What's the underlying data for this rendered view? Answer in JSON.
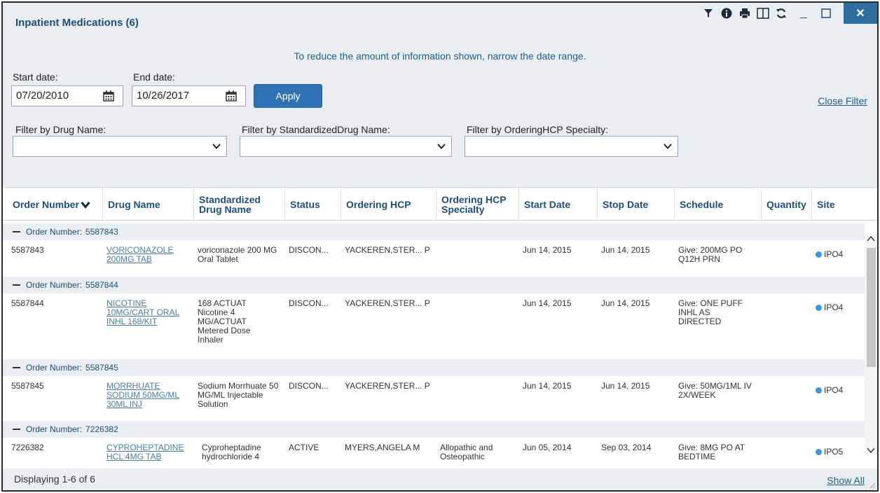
{
  "window": {
    "title": "Inpatient Medications (6)",
    "toolbar_icons": [
      "filter-icon",
      "info-icon",
      "print-icon",
      "columns-icon",
      "refresh-icon"
    ],
    "minimize_label": "_",
    "close_label": "✕"
  },
  "filters": {
    "hint": "To reduce the amount of information shown, narrow the date range.",
    "start_label": "Start date:",
    "start_value": "07/20/2010",
    "end_label": "End date:",
    "end_value": "10/26/2017",
    "apply_label": "Apply",
    "close_filter_label": "Close Filter",
    "drug_name_label": "Filter by Drug Name:",
    "standardized_label": "Filter by StandardizedDrug Name:",
    "specialty_label": "Filter by OrderingHCP Specialty:",
    "drug_name_value": "",
    "standardized_value": "",
    "specialty_value": ""
  },
  "columns": [
    {
      "label": "Order Number"
    },
    {
      "label": "Drug Name"
    },
    {
      "label": "Standardized Drug Name"
    },
    {
      "label": "Status"
    },
    {
      "label": "Ordering HCP"
    },
    {
      "label": "Ordering HCP Specialty"
    },
    {
      "label": "Start Date"
    },
    {
      "label": "Stop Date"
    },
    {
      "label": "Schedule"
    },
    {
      "label": "Quantity"
    },
    {
      "label": "Site"
    }
  ],
  "groups": [
    {
      "label": "Order Number:",
      "number": "5587843",
      "row": {
        "order": "5587843",
        "drug": "VORICONAZOLE 200MG TAB",
        "std": "voriconazole 200 MG Oral Tablet",
        "status": "DISCON...",
        "hcp": "YACKEREN,STER... P",
        "specialty": "",
        "start": "Jun 14, 2015",
        "stop": "Jun 14, 2015",
        "schedule": "Give: 200MG PO Q12H PRN",
        "quantity": "",
        "site": "IPO4"
      }
    },
    {
      "label": "Order Number:",
      "number": "5587844",
      "row": {
        "order": "5587844",
        "drug": "NICOTINE 10MG/CART ORAL INHL 168/KIT",
        "std": "168 ACTUAT Nicotine 4 MG/ACTUAT Metered Dose Inhaler",
        "status": "DISCON...",
        "hcp": "YACKEREN,STER... P",
        "specialty": "",
        "start": "Jun 14, 2015",
        "stop": "Jun 14, 2015",
        "schedule": "Give: ONE PUFF INHL AS DIRECTED",
        "quantity": "",
        "site": "IPO4"
      }
    },
    {
      "label": "Order Number:",
      "number": "5587845",
      "row": {
        "order": "5587845",
        "drug": "MORRHUATE SODIUM 50MG/ML 30ML INJ",
        "std": "Sodium Morrhuate 50 MG/ML Injectable Solution",
        "status": "DISCON...",
        "hcp": "YACKEREN,STER... P",
        "specialty": "",
        "start": "Jun 14, 2015",
        "stop": "Jun 14, 2015",
        "schedule": "Give: 50MG/1ML IV 2X/WEEK",
        "quantity": "",
        "site": "IPO4"
      }
    },
    {
      "label": "Order Number:",
      "number": "7226382",
      "row": {
        "order": "7226382",
        "drug": "CYPROHEPTADINE HCL 4MG TAB",
        "std": "Cyproheptadine hydrochloride 4",
        "status": "ACTIVE",
        "hcp": "MYERS,ANGELA M",
        "specialty": "Allopathic and Osteopathic",
        "start": "Jun 05, 2014",
        "stop": "Sep 03, 2014",
        "schedule": "Give: 8MG PO AT BEDTIME",
        "quantity": "",
        "site": "IPO5"
      }
    }
  ],
  "footer": {
    "displaying": "Displaying 1-6 of 6",
    "show_all": "Show All"
  },
  "colors": {
    "header_bg": "#e9eef2",
    "title": "#1f4e79",
    "link": "#1f5f8b",
    "apply": "#2f73b5",
    "close": "#2f6fa0",
    "site_dot": "#3b97dd"
  }
}
